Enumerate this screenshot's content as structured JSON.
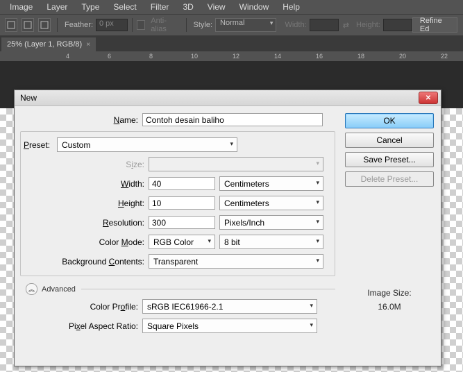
{
  "menu": {
    "items": [
      "Image",
      "Layer",
      "Type",
      "Select",
      "Filter",
      "3D",
      "View",
      "Window",
      "Help"
    ]
  },
  "options_bar": {
    "feather_label": "Feather:",
    "feather_value": "0 px",
    "anti_alias": "Anti-alias",
    "style_label": "Style:",
    "style_value": "Normal",
    "width_label": "Width:",
    "height_label": "Height:",
    "refine": "Refine Ed"
  },
  "tab_title": "25% (Layer 1, RGB/8)",
  "ruler_ticks": [
    "4",
    "6",
    "8",
    "10",
    "12",
    "14",
    "16",
    "18",
    "20",
    "22"
  ],
  "dialog": {
    "title": "New",
    "name_label": "Name:",
    "name_value": "Contoh desain baliho",
    "preset_label": "Preset:",
    "preset_value": "Custom",
    "size_label": "Size:",
    "width_label": "Width:",
    "width_value": "40",
    "width_unit": "Centimeters",
    "height_label": "Height:",
    "height_value": "10",
    "height_unit": "Centimeters",
    "resolution_label": "Resolution:",
    "resolution_value": "300",
    "resolution_unit": "Pixels/Inch",
    "colormode_label": "Color Mode:",
    "colormode_value": "RGB Color",
    "colordepth_value": "8 bit",
    "bgcontents_label": "Background Contents:",
    "bgcontents_value": "Transparent",
    "advanced_label": "Advanced",
    "colorprofile_label": "Color Profile:",
    "colorprofile_value": "sRGB IEC61966-2.1",
    "par_label": "Pixel Aspect Ratio:",
    "par_value": "Square Pixels",
    "ok": "OK",
    "cancel": "Cancel",
    "save_preset": "Save Preset...",
    "delete_preset": "Delete Preset...",
    "image_size_label": "Image Size:",
    "image_size_value": "16.0M"
  }
}
